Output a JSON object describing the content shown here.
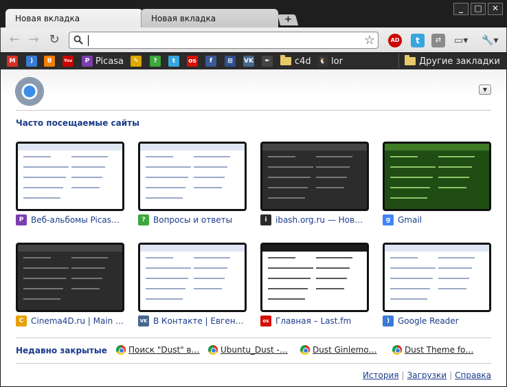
{
  "tabs": [
    {
      "label": "Новая вкладка",
      "active": true
    },
    {
      "label": "Новая вкладка",
      "active": false
    }
  ],
  "window_controls": {
    "minimize": "_",
    "maximize": "□",
    "close": "✕"
  },
  "toolbar": {
    "back_icon": "back-arrow-icon",
    "forward_icon": "forward-arrow-icon",
    "reload_icon": "reload-icon",
    "omnibox_value": "",
    "star_icon": "star-icon"
  },
  "bookmarks": [
    {
      "label": "",
      "icon": "gmail-icon",
      "color": "#d93025",
      "glyph": "M"
    },
    {
      "label": "",
      "icon": "rss-icon",
      "color": "#3a7bd5",
      "glyph": ")"
    },
    {
      "label": "",
      "icon": "blogger-icon",
      "color": "#f57d00",
      "glyph": "B"
    },
    {
      "label": "",
      "icon": "youtube-icon",
      "color": "#cc0000",
      "glyph": "You"
    },
    {
      "label": "Picasa",
      "icon": "picasa-icon",
      "color": "#7c3fb0",
      "glyph": "P"
    },
    {
      "label": "",
      "icon": "delicious-icon",
      "color": "#e0a800",
      "glyph": "✎"
    },
    {
      "label": "",
      "icon": "question-icon",
      "color": "#3aa83a",
      "glyph": "?"
    },
    {
      "label": "",
      "icon": "twitter-icon",
      "color": "#37a6dc",
      "glyph": "t"
    },
    {
      "label": "",
      "icon": "lastfm-icon",
      "color": "#d51007",
      "glyph": "os"
    },
    {
      "label": "",
      "icon": "facebook-icon",
      "color": "#3b5998",
      "glyph": "f"
    },
    {
      "label": "",
      "icon": "friendfeed-icon",
      "color": "#2f4f8f",
      "glyph": "⊞"
    },
    {
      "label": "",
      "icon": "vk-icon",
      "color": "#45668e",
      "glyph": "VK"
    },
    {
      "label": "",
      "icon": "feather-icon",
      "color": "#444444",
      "glyph": "✒"
    },
    {
      "label": "c4d",
      "icon": "folder-icon",
      "color": "#e8c96a",
      "glyph": ""
    },
    {
      "label": "lor",
      "icon": "tux-icon",
      "color": "#333333",
      "glyph": "🐧"
    }
  ],
  "other_bookmarks": "Другие закладки",
  "most_visited_title": "Часто посещаемые сайты",
  "most_visited": [
    {
      "label": "Веб-альбомы Picas…",
      "icon": "picasa-icon",
      "color": "#7c3fb0",
      "glyph": "P",
      "theme": "light"
    },
    {
      "label": "Вопросы и ответы",
      "icon": "question-icon",
      "color": "#3aa83a",
      "glyph": "?",
      "theme": "light"
    },
    {
      "label": "ibash.org.ru — Новы…",
      "icon": "ibash-icon",
      "color": "#2a2a2a",
      "glyph": "i",
      "theme": "dark"
    },
    {
      "label": "Gmail",
      "icon": "gmail-google-icon",
      "color": "#4285f4",
      "glyph": "g",
      "theme": "green"
    },
    {
      "label": "Cinema4D.ru | Main …",
      "icon": "cinema4d-icon",
      "color": "#e8a000",
      "glyph": "C",
      "theme": "dark"
    },
    {
      "label": "В Контакте | Евгений…",
      "icon": "vk-icon",
      "color": "#45668e",
      "glyph": "VK",
      "theme": "light"
    },
    {
      "label": "Главная – Last.fm",
      "icon": "lastfm-icon",
      "color": "#d51007",
      "glyph": "os",
      "theme": "lastfm"
    },
    {
      "label": "Google Reader",
      "icon": "google-reader-icon",
      "color": "#3a7bd5",
      "glyph": ")",
      "theme": "light"
    }
  ],
  "recently_closed_title": "Недавно закрытые",
  "recently_closed": [
    {
      "label": "Поиск \"Dust\" в…"
    },
    {
      "label": "Ubuntu_Dust -…"
    },
    {
      "label": "Dust Ginlemo…"
    },
    {
      "label": "Dust Theme fo…"
    }
  ],
  "footer": {
    "history": "История",
    "downloads": "Загрузки",
    "help": "Справка"
  }
}
